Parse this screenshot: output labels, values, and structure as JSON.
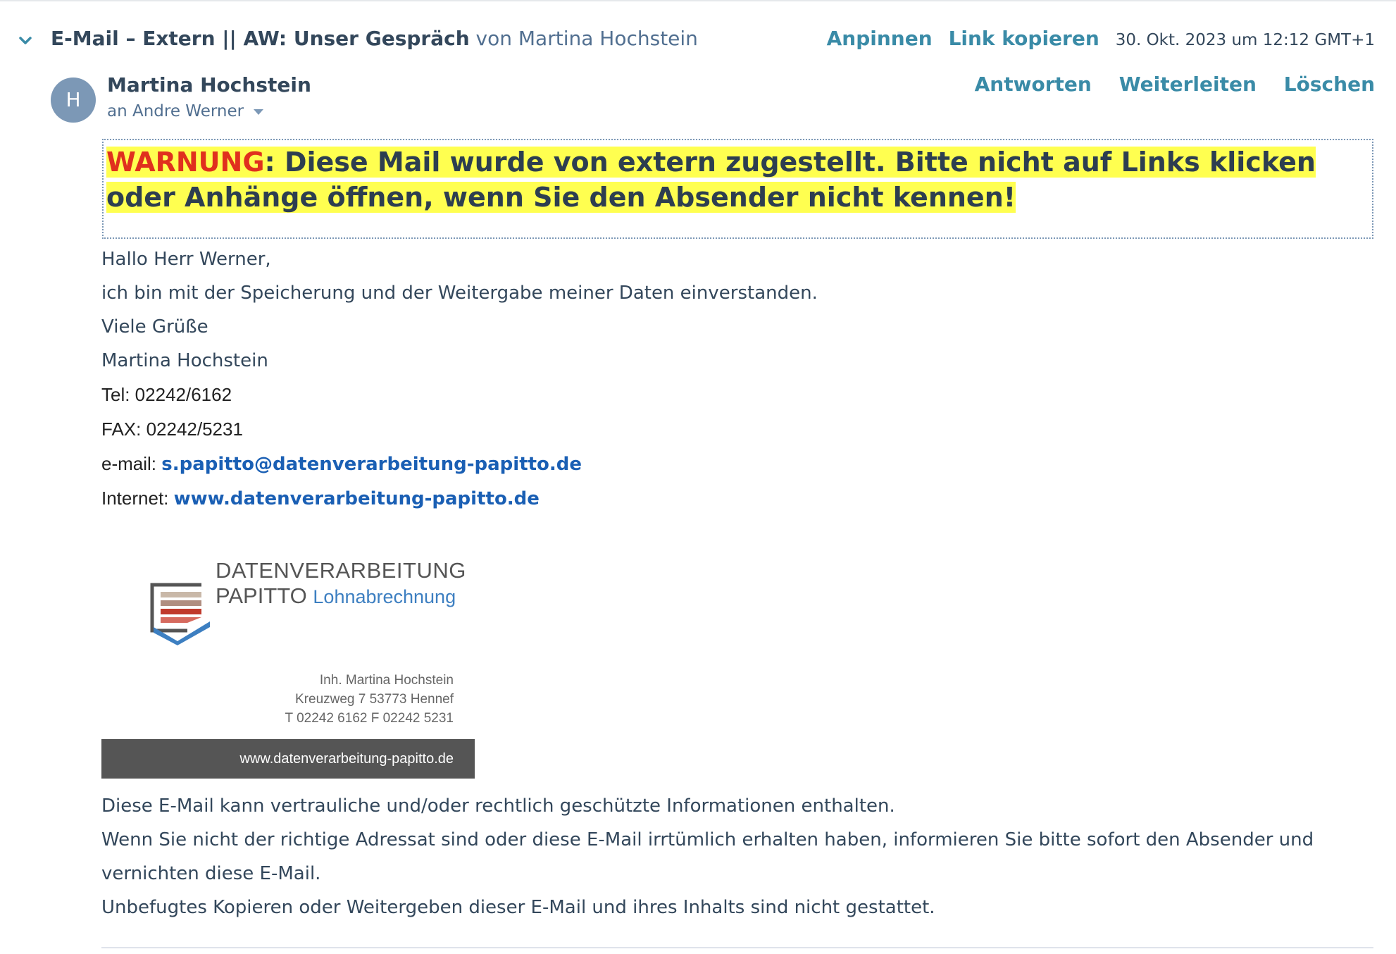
{
  "header": {
    "subject_bold": "E-Mail – Extern || AW: Unser Gespräch",
    "subject_from": " von Martina Hochstein",
    "pin_label": "Anpinnen",
    "copy_link_label": "Link kopieren",
    "date": "30. Okt. 2023 um 12:12 GMT+1"
  },
  "message": {
    "avatar_letter": "H",
    "sender_name": "Martina Hochstein",
    "recipient": "an Andre Werner",
    "actions": {
      "reply": "Antworten",
      "forward": "Weiterleiten",
      "delete": "Löschen"
    }
  },
  "warning": {
    "label": "WARNUNG",
    "text": ": Diese Mail wurde von extern zugestellt. Bitte nicht auf Links klicken oder Anhänge öffnen, wenn Sie den Absender nicht kennen!"
  },
  "body": {
    "greeting": "Hallo Herr Werner,",
    "line1": "ich bin mit der Speicherung und der Weitergabe meiner Daten einverstanden.",
    "closing": "Viele Grüße",
    "name": "Martina Hochstein",
    "tel": "Tel: 02242/6162",
    "fax": "FAX: 02242/5231",
    "email_label": "e-mail: ",
    "email": "s.papitto@datenverarbeitung-papitto.de",
    "internet_label": "Internet: ",
    "website": "www.datenverarbeitung-papitto.de"
  },
  "signature_logo": {
    "title1": "DATENVERARBEITUNG",
    "title2": "PAPITTO",
    "title2_sub": "Lohnabrechnung",
    "owner": "Inh. Martina Hochstein",
    "street": "Kreuzweg 7   53773 Hennef",
    "phones": "T 02242 6162   F 02242 5231",
    "url": "www.datenverarbeitung-papitto.de",
    "colors": {
      "bar": "#555555",
      "blue": "#3d7fc1",
      "red": "#c0392b"
    }
  },
  "disclaimer": {
    "line1": "Diese E-Mail kann vertrauliche und/oder rechtlich geschützte Informationen enthalten.",
    "line2": "Wenn Sie nicht der richtige Adressat sind oder diese E-Mail irrtümlich erhalten haben, informieren Sie bitte sofort den Absender und vernichten diese E-Mail.",
    "line3": "Unbefugtes Kopieren oder Weitergeben dieser E-Mail und ihres Inhalts sind nicht gestattet."
  },
  "icons": {
    "collapse": "chevron-down-icon",
    "recipient_toggle": "caret-down-icon"
  },
  "colors": {
    "link": "#3a8ba7",
    "warning_red": "#e0301e",
    "highlight": "#ffff50",
    "avatar": "#7c98b6"
  }
}
